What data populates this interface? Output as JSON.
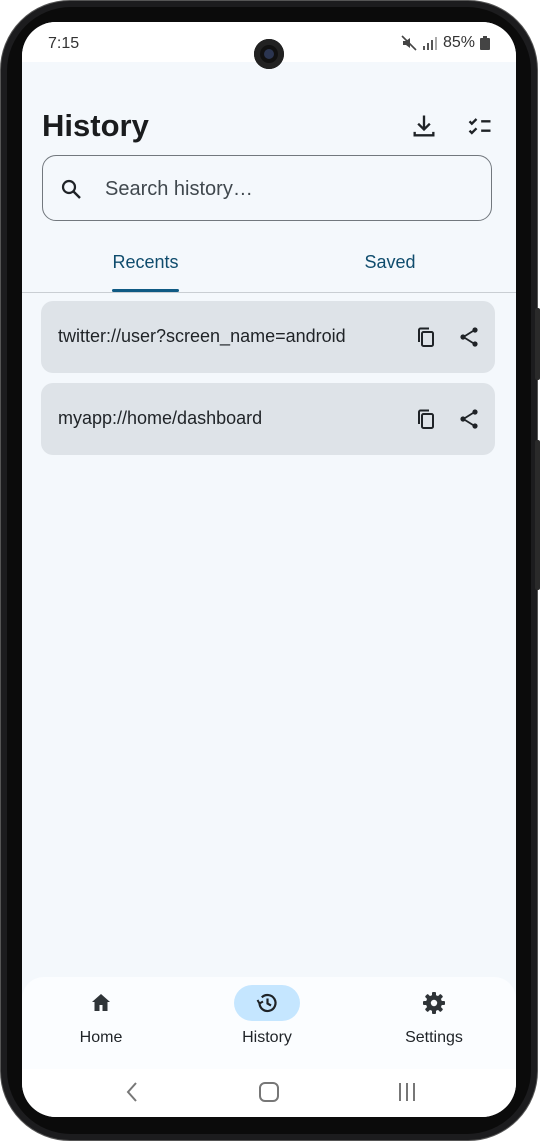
{
  "status_bar": {
    "time": "7:15",
    "battery": "85%",
    "icons": [
      "mute-icon",
      "signal-icon",
      "battery-icon"
    ]
  },
  "header": {
    "title": "History",
    "actions": [
      "download-icon",
      "select-checklist-icon"
    ]
  },
  "search": {
    "placeholder": "Search history…",
    "value": ""
  },
  "tabs": [
    {
      "label": "Recents",
      "selected": true
    },
    {
      "label": "Saved",
      "selected": false
    }
  ],
  "history_items": [
    {
      "text": "twitter://user?screen_name=android",
      "actions": [
        "copy-icon",
        "share-icon"
      ]
    },
    {
      "text": "myapp://home/dashboard",
      "actions": [
        "copy-icon",
        "share-icon"
      ]
    }
  ],
  "bottom_nav": [
    {
      "label": "Home",
      "icon": "home-icon",
      "active": false
    },
    {
      "label": "History",
      "icon": "history-icon",
      "active": true
    },
    {
      "label": "Settings",
      "icon": "gear-icon",
      "active": false
    }
  ],
  "system_nav": [
    "back-icon",
    "home-circle-icon",
    "recents-icon"
  ],
  "colors": {
    "background": "#f4f8fc",
    "accent": "#0f4c6d",
    "card": "#dee3e8",
    "active_nav_pill": "#c5e6ff"
  }
}
